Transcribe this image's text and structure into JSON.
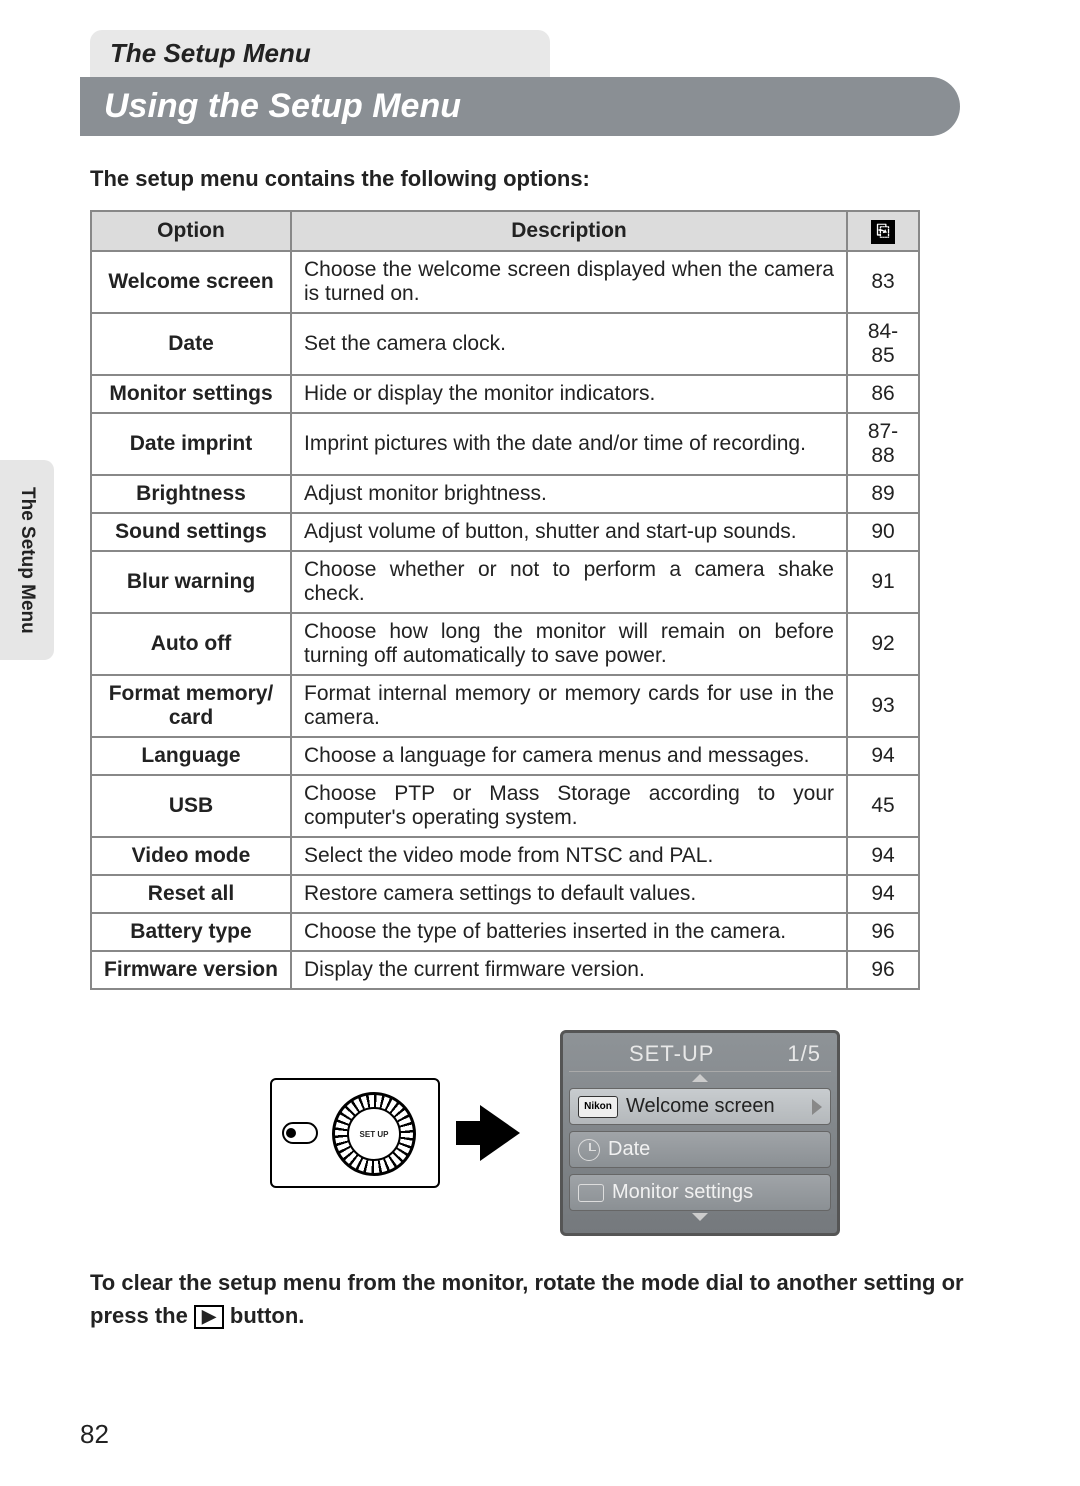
{
  "chapter_tab": "The Setup Menu",
  "title": "Using the Setup Menu",
  "intro": "The setup menu contains the following options:",
  "side_tab": "The Setup Menu",
  "table": {
    "headers": {
      "option": "Option",
      "description": "Description",
      "page_icon": "⎘"
    },
    "rows": [
      {
        "option": "Welcome screen",
        "description": "Choose the welcome screen displayed when the camera is turned on.",
        "page": "83"
      },
      {
        "option": "Date",
        "description": "Set the camera clock.",
        "page": "84-85"
      },
      {
        "option": "Monitor settings",
        "description": "Hide or display the monitor indicators.",
        "page": "86"
      },
      {
        "option": "Date imprint",
        "description": "Imprint pictures with the date and/or time of recording.",
        "page": "87-88"
      },
      {
        "option": "Brightness",
        "description": "Adjust monitor brightness.",
        "page": "89"
      },
      {
        "option": "Sound settings",
        "description": "Adjust volume of button, shutter and start-up sounds.",
        "page": "90"
      },
      {
        "option": "Blur warning",
        "description": "Choose whether or not to perform a camera shake check.",
        "page": "91"
      },
      {
        "option": "Auto off",
        "description": "Choose how long the monitor will remain on before turning off automatically to save power.",
        "page": "92"
      },
      {
        "option": "Format memory/ card",
        "description": "Format internal memory or memory cards for use in the camera.",
        "page": "93"
      },
      {
        "option": "Language",
        "description": "Choose a language for camera menus and messages.",
        "page": "94"
      },
      {
        "option": "USB",
        "description": "Choose PTP or Mass Storage according to your computer's operating system.",
        "page": "45"
      },
      {
        "option": "Video mode",
        "description": "Select the video mode from NTSC and PAL.",
        "page": "94"
      },
      {
        "option": "Reset all",
        "description": "Restore camera settings to default values.",
        "page": "94"
      },
      {
        "option": "Battery type",
        "description": "Choose the type of batteries inserted in the camera.",
        "page": "96"
      },
      {
        "option": "Firmware version",
        "description": "Display the current firmware version.",
        "page": "96"
      }
    ]
  },
  "dial_label": "SET UP",
  "lcd": {
    "title": "SET-UP",
    "page": "1/5",
    "items": [
      {
        "icon_label": "Nikon",
        "label": "Welcome screen",
        "selected": true
      },
      {
        "icon_label": "clock",
        "label": "Date",
        "selected": false
      },
      {
        "icon_label": "monitor",
        "label": "Monitor settings",
        "selected": false
      }
    ]
  },
  "footer_pre": "To clear the setup menu from the monitor, rotate the mode dial to another setting or press the ",
  "footer_btn": "▶",
  "footer_post": " button.",
  "page_number": "82"
}
